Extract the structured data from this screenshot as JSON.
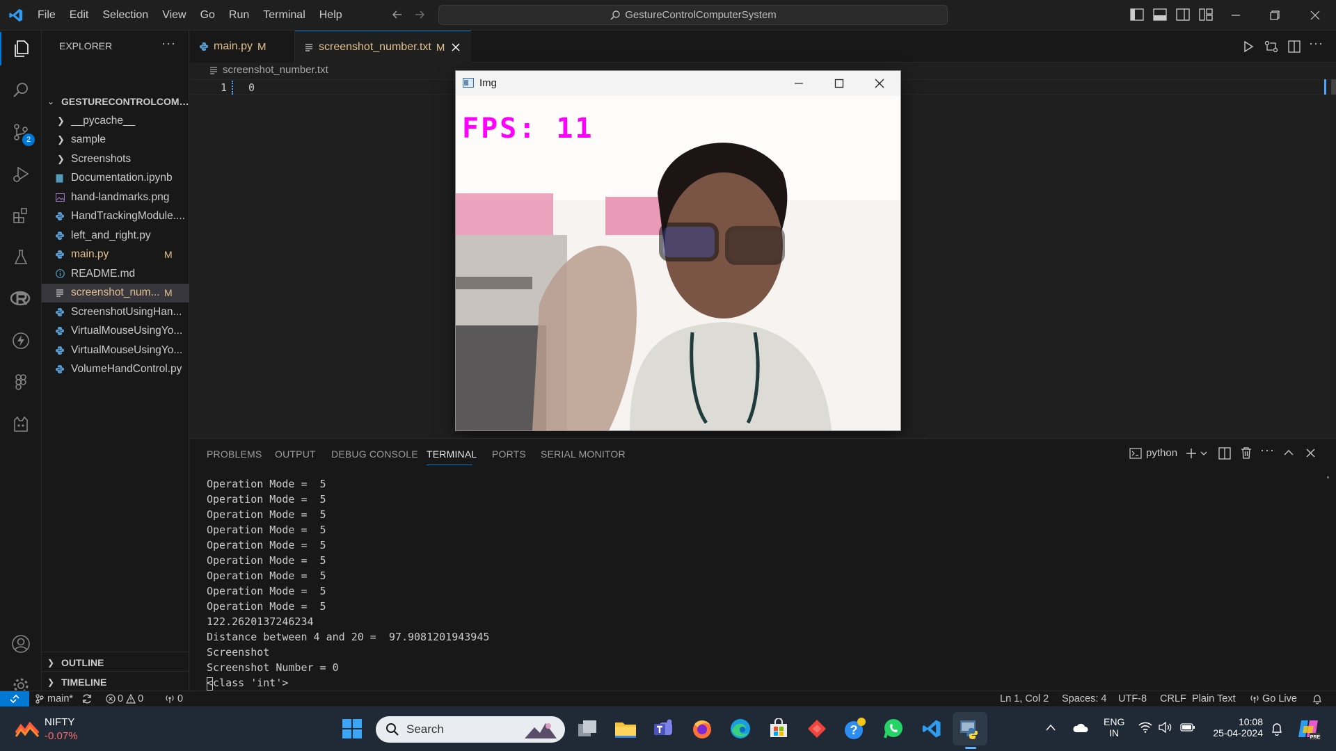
{
  "titlebar": {
    "menu": [
      "File",
      "Edit",
      "Selection",
      "View",
      "Go",
      "Run",
      "Terminal",
      "Help"
    ],
    "search": "GestureControlComputerSystem"
  },
  "activity": {
    "scm_badge": "2"
  },
  "explorer": {
    "header": "EXPLORER",
    "more": "···",
    "root": "GESTURECONTROLCOMPU...",
    "items": [
      {
        "name": "__pycache__",
        "kind": "folder",
        "badge": ""
      },
      {
        "name": "sample",
        "kind": "folder",
        "badge": ""
      },
      {
        "name": "Screenshots",
        "kind": "folder",
        "badge": ""
      },
      {
        "name": "Documentation.ipynb",
        "kind": "notebook",
        "badge": ""
      },
      {
        "name": "hand-landmarks.png",
        "kind": "image",
        "badge": ""
      },
      {
        "name": "HandTrackingModule....",
        "kind": "python",
        "badge": ""
      },
      {
        "name": "left_and_right.py",
        "kind": "python",
        "badge": ""
      },
      {
        "name": "main.py",
        "kind": "python",
        "badge": "M"
      },
      {
        "name": "README.md",
        "kind": "info",
        "badge": ""
      },
      {
        "name": "screenshot_num...",
        "kind": "text",
        "badge": "M"
      },
      {
        "name": "ScreenshotUsingHan...",
        "kind": "python",
        "badge": ""
      },
      {
        "name": "VirtualMouseUsingYo...",
        "kind": "python",
        "badge": ""
      },
      {
        "name": "VirtualMouseUsingYo...",
        "kind": "python",
        "badge": ""
      },
      {
        "name": "VolumeHandControl.py",
        "kind": "python",
        "badge": ""
      }
    ],
    "outline": "OUTLINE",
    "timeline": "TIMELINE"
  },
  "tabs": [
    {
      "label": "main.py",
      "badge": "M",
      "active": false
    },
    {
      "label": "screenshot_number.txt",
      "badge": "M",
      "active": true
    }
  ],
  "editor": {
    "breadcrumb": "screenshot_number.txt",
    "line_number": "1",
    "line_text": "0"
  },
  "img_window": {
    "title": "Img",
    "fps_text": "FPS: 11"
  },
  "panel": {
    "tabs": [
      "PROBLEMS",
      "OUTPUT",
      "DEBUG CONSOLE",
      "TERMINAL",
      "PORTS",
      "SERIAL MONITOR"
    ],
    "active_tab": "TERMINAL",
    "shell": "python",
    "terminal_lines": [
      "Operation Mode =  5",
      "Operation Mode =  5",
      "Operation Mode =  5",
      "Operation Mode =  5",
      "Operation Mode =  5",
      "Operation Mode =  5",
      "Operation Mode =  5",
      "Operation Mode =  5",
      "Operation Mode =  5",
      "122.2620137246234",
      "Distance between 4 and 20 =  97.9081201943945",
      "Screenshot",
      "Screenshot Number = 0",
      "<class 'int'>"
    ]
  },
  "statusbar": {
    "branch": "main*",
    "errors": "0",
    "warnings": "0",
    "ports": "0",
    "position": "Ln 1, Col 2",
    "spaces": "Spaces: 4",
    "encoding": "UTF-8",
    "eol": "CRLF",
    "language": "Plain Text",
    "golive": "Go Live"
  },
  "taskbar": {
    "ticker": "NIFTY",
    "change": "-0.07%",
    "search": "Search",
    "lang_top": "ENG",
    "lang_bottom": "IN",
    "time": "10:08",
    "date": "25-04-2024"
  },
  "colors": {
    "accent": "#0078d4",
    "modified": "#e2c08d",
    "fps_magenta": "#ff00ff",
    "negative": "#ff6b6b"
  }
}
